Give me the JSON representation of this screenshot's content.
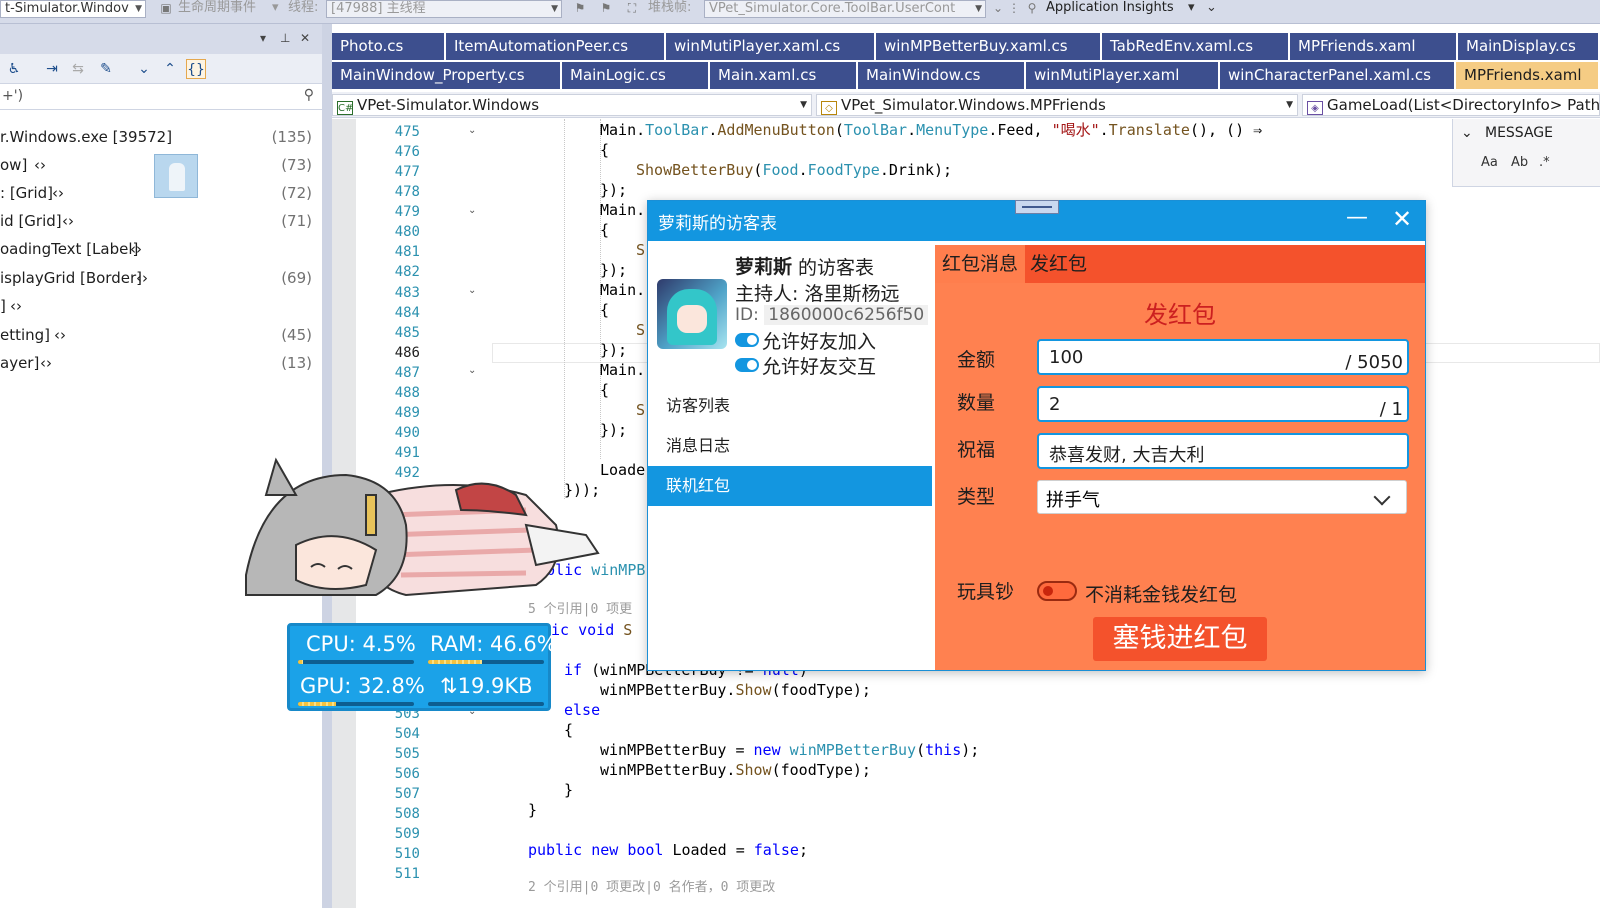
{
  "toolbar": {
    "startup_project": "t-Simulator.Windov",
    "lifecycle_label": "生命周期事件",
    "thread_label": "线程:",
    "thread_value": "[47988] 主线程",
    "stack_label": "堆栈帧:",
    "stack_value": "VPet_Simulator.Core.ToolBar.UserCont",
    "insights": "Application Insights"
  },
  "left_panel": {
    "search_text": "+')",
    "tree": [
      {
        "name": "r.Windows.exe [39572]",
        "count": "(135)"
      },
      {
        "name": "ow]",
        "count": "(73)"
      },
      {
        "name": ": [Grid]",
        "count": "(72)"
      },
      {
        "name": "id [Grid]",
        "count": "(71)"
      },
      {
        "name": "oadingText [Label]",
        "count": ""
      },
      {
        "name": "isplayGrid [Border]",
        "count": "(69)"
      },
      {
        "name": "]",
        "count": ""
      },
      {
        "name": "etting]",
        "count": "(45)"
      },
      {
        "name": "ayer]",
        "count": "(13)"
      }
    ]
  },
  "tabs": {
    "row1": [
      "Photo.cs",
      "ItemAutomationPeer.cs",
      "winMutiPlayer.xaml.cs",
      "winMPBetterBuy.xaml.cs",
      "TabRedEnv.xaml.cs",
      "MPFriends.xaml",
      "MainDisplay.cs"
    ],
    "row2": [
      "MainWindow_Property.cs",
      "MainLogic.cs",
      "Main.xaml.cs",
      "MainWindow.cs",
      "winMutiPlayer.xaml",
      "winCharacterPanel.xaml.cs",
      "MPFriends.xaml"
    ]
  },
  "nav": {
    "project": "VPet-Simulator.Windows",
    "type": "VPet_Simulator.Windows.MPFriends",
    "member": "GameLoad(List<DirectoryInfo> Path"
  },
  "editor": {
    "line_numbers": [
      "475",
      "476",
      "477",
      "478",
      "479",
      "480",
      "481",
      "482",
      "483",
      "484",
      "485",
      "486",
      "487",
      "488",
      "489",
      "490",
      "491",
      "492"
    ],
    "line_numbers_bottom": [
      "503",
      "504",
      "505",
      "506",
      "507",
      "508",
      "509",
      "510",
      "511"
    ],
    "codelens_1": "5 个引用|0 项更",
    "codelens_2": "2 个引用|0 项更改|0 名作者，0 项更改"
  },
  "message_panel": {
    "title": "MESSAGE"
  },
  "perf": {
    "cpu": "CPU: 4.5%",
    "ram": "RAM: 46.6%",
    "gpu": "GPU: 32.8%",
    "net": "⇅19.9KB",
    "cpu_fraction": 0.045,
    "ram_fraction": 0.466,
    "gpu_fraction": 0.328
  },
  "dialog": {
    "title": "萝莉斯的访客表",
    "owner_name": "萝莉斯",
    "owner_suffix": " 的访客表",
    "host": "主持人: 洛里斯杨远",
    "id_label": "ID:",
    "id_value": "1860000c6256f50",
    "allow_join": "允许好友加入",
    "allow_interact": "允许好友交互",
    "nav": [
      "访客列表",
      "消息日志",
      "联机红包"
    ],
    "red_tabs": [
      "红包消息",
      "发红包"
    ],
    "red_title": "发红包",
    "amount_label": "金额",
    "amount_value": "100",
    "amount_max": "/ 5050",
    "count_label": "数量",
    "count_value": "2",
    "count_max": "/ 1",
    "blessing_label": "祝福",
    "blessing_value": "恭喜发财, 大吉大利",
    "type_label": "类型",
    "type_value": "拼手气",
    "toy_label": "玩具钞",
    "toy_desc": "不消耗金钱发红包",
    "send_button": "塞钱进红包"
  }
}
